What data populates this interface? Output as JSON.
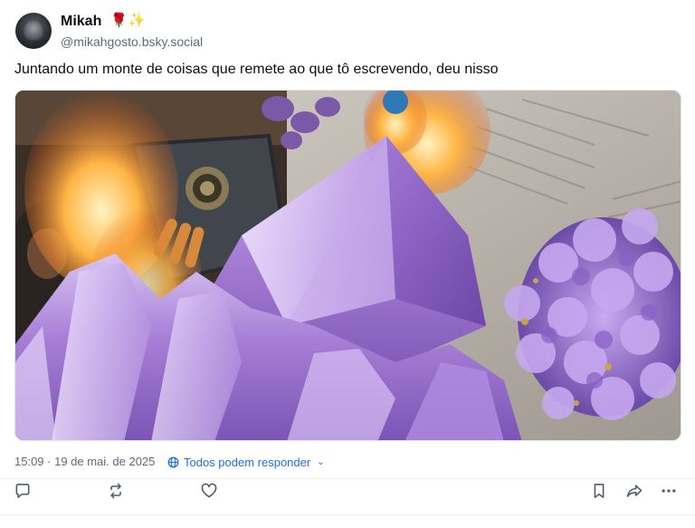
{
  "post": {
    "author": {
      "display_name": "Mikah",
      "name_emoji": "🌹✨",
      "handle": "@mikahgosto.bsky.social"
    },
    "text": "Juntando um monte de coisas que remete ao que tô escrevendo, deu nisso",
    "timestamp": "15:09 · 19 de mai. de 2025",
    "reply_setting": "Todos podem responder",
    "colors": {
      "accent": "#1f6fde",
      "secondary_text": "#5d6a7a",
      "amethyst": "#a77fd6"
    },
    "actions": [
      {
        "icon": "reply-icon"
      },
      {
        "icon": "repost-icon"
      },
      {
        "icon": "like-heart-icon"
      },
      {
        "icon": "bookmark-icon"
      },
      {
        "icon": "share-icon"
      },
      {
        "icon": "more-options-icon"
      }
    ]
  }
}
